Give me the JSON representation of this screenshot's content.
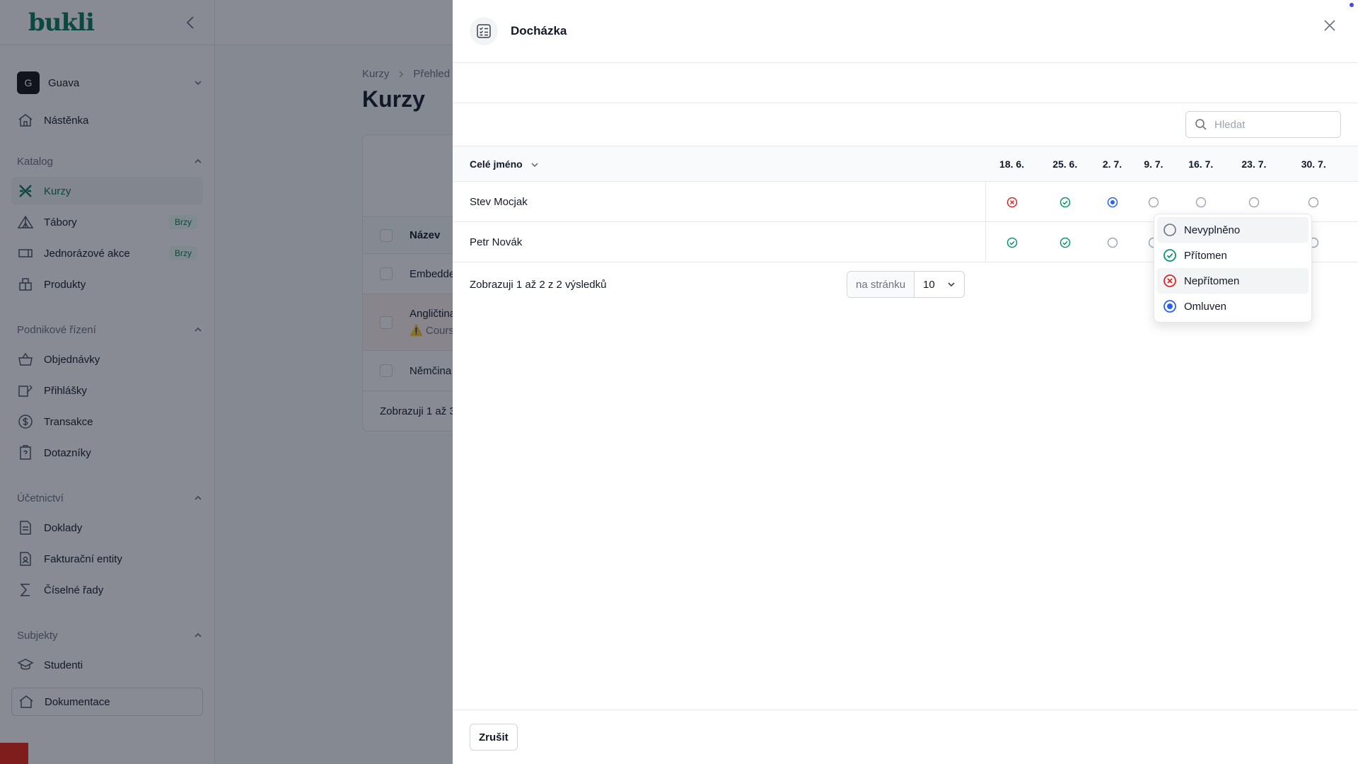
{
  "app": {
    "logo": "bukli",
    "tenant": {
      "initial": "G",
      "name": "Guava"
    },
    "nav": {
      "dashboard": "Nástěnka",
      "catalog_section": "Katalog",
      "courses": "Kurzy",
      "camps": "Tábory",
      "one_time": "Jednorázové akce",
      "products": "Produkty",
      "soon": "Brzy",
      "business_section": "Podnikové řízení",
      "orders": "Objednávky",
      "applications": "Přihlášky",
      "transactions": "Transakce",
      "questionnaires": "Dotazníky",
      "accounting_section": "Účetnictví",
      "documents": "Doklady",
      "billing_entities": "Fakturační entity",
      "number_series": "Číselné řady",
      "subjects_section": "Subjekty",
      "students": "Studenti",
      "documentation": "Dokumentace"
    },
    "breadcrumb": [
      "Kurzy",
      "Přehled"
    ],
    "page_title": "Kurzy",
    "table": {
      "col_name": "Název",
      "rows": [
        "Embedde",
        "Angličtina",
        "Němčina"
      ],
      "warning": "Course",
      "footer": "Zobrazuji 1 až 3"
    }
  },
  "panel": {
    "title": "Docházka",
    "search_placeholder": "Hledat",
    "col_name": "Celé jméno",
    "dates": [
      "18. 6.",
      "25. 6.",
      "2. 7.",
      "9. 7.",
      "16. 7.",
      "23. 7.",
      "30. 7."
    ],
    "rows": [
      {
        "name": "Stev Mocjak",
        "status": [
          "absent",
          "present",
          "excused",
          "empty",
          "empty",
          "empty",
          "empty"
        ]
      },
      {
        "name": "Petr Novák",
        "status": [
          "present",
          "present",
          "empty",
          "empty",
          "empty",
          "empty",
          "empty"
        ]
      }
    ],
    "results": "Zobrazuji 1 až 2 z 2 výsledků",
    "per_page_label": "na stránku",
    "per_page_value": "10",
    "cancel": "Zrušit",
    "status_options": {
      "empty": "Nevyplněno",
      "present": "Přítomen",
      "absent": "Nepřítomen",
      "excused": "Omluven"
    }
  },
  "colors": {
    "brand": "#047857",
    "present": "#059669",
    "absent": "#dc2626",
    "excused": "#2563eb",
    "empty": "#9ca3af"
  }
}
